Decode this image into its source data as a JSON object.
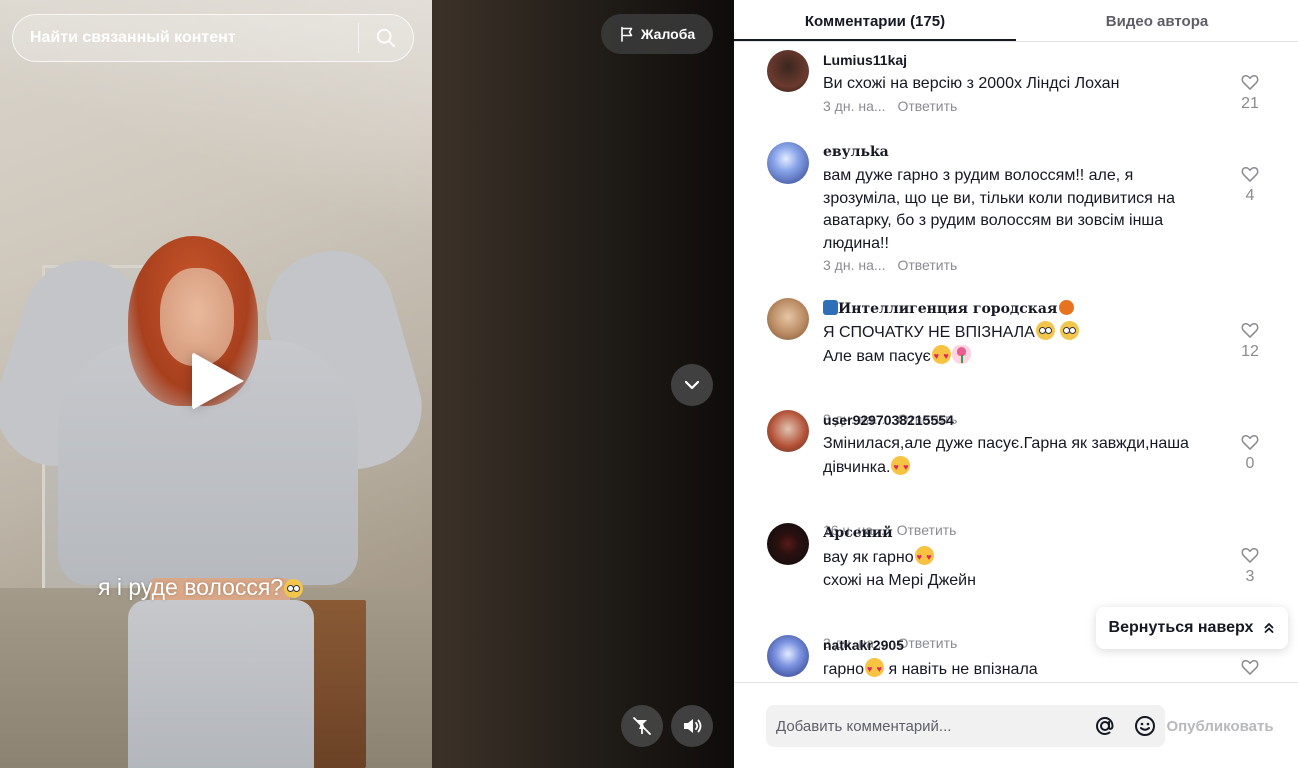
{
  "video": {
    "search_placeholder": "Найти связанный контент",
    "report_label": "Жалоба",
    "caption": "я і руде волосся?",
    "caption_emoji": "flushed-face"
  },
  "panel": {
    "tabs": [
      {
        "label": "Комментарии (175)",
        "active": true
      },
      {
        "label": "Видео автора",
        "active": false
      }
    ],
    "comments": [
      {
        "user": "Lumius11kaj",
        "text": "Ви схожі на версію з 2000х Ліндсі Лохан",
        "time": "3 дн. на...",
        "reply": "Ответить",
        "likes": "21",
        "avatar_color": "#4a2b22"
      },
      {
        "user": "евульkа",
        "text": "вам дуже гарно з рудим волоссям!! але, я зрозуміла, що це ви, тільки коли подивитися на аватарку, бо з рудим волоссям ви зовсім інша людина!!",
        "time": "3 дн. на...",
        "reply": "Ответить",
        "likes": "4",
        "avatar_color": "#3d5aa8"
      },
      {
        "user": "Интеллигенция городская",
        "text_line1": "Я СПОЧАТКУ НЕ ВПІЗНАЛА",
        "text_line2": "Але вам пасує",
        "time": "3 дн. на...",
        "reply": "Ответить",
        "likes": "12",
        "avatar_color": "#c9a07e"
      },
      {
        "user": "user9297038215554",
        "text": "Змінилася,але дуже пасує.Гарна як завжди,наша дівчинка.",
        "time": "16 ч. на...",
        "reply": "Ответить",
        "likes": "0",
        "avatar_color": "#a8442e"
      },
      {
        "user": "Арсений",
        "text_line1": "вау як гарно",
        "text_line2": "схожі на Мері Джейн",
        "time": "3 дн. на...",
        "reply": "Ответить",
        "likes": "3",
        "avatar_color": "#1d1d1d"
      },
      {
        "user": "natkakr2905",
        "text": "гарно",
        "text_tail": " я навіть не впізнала",
        "time": "",
        "reply": "",
        "likes": "",
        "avatar_color": "#3a4fa3"
      }
    ],
    "back_to_top": "Вернуться наверх",
    "comment_placeholder": "Добавить комментарий...",
    "publish_label": "Опубликовать"
  },
  "colors": {
    "accent_text": "#161823",
    "muted_text": "#8a8b91",
    "like_outline": "#8a8b91"
  }
}
